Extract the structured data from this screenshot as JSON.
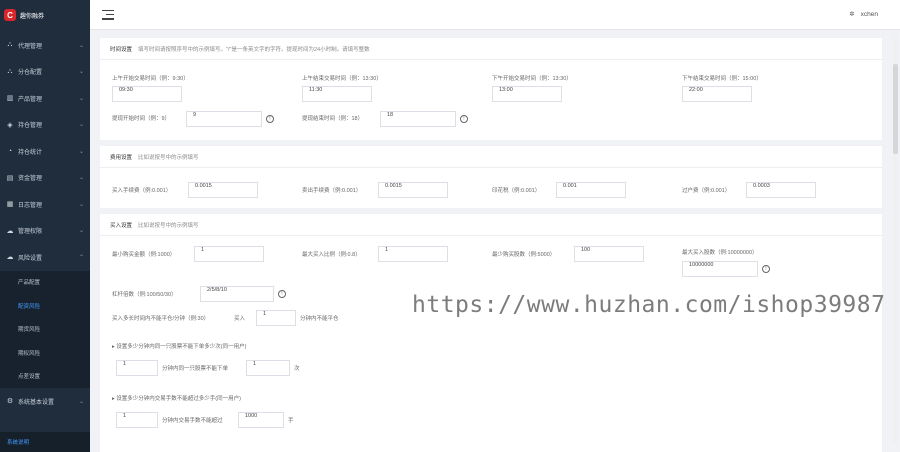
{
  "app": {
    "logo_text": "趣你融券",
    "logo_badge": "C"
  },
  "sidebar": {
    "items": [
      {
        "label": "代理管理",
        "icon": "sitemap-icon"
      },
      {
        "label": "分仓配置",
        "icon": "sitemap-icon"
      },
      {
        "label": "产品管理",
        "icon": "chart-icon"
      },
      {
        "label": "持仓管理",
        "icon": "stack-icon"
      },
      {
        "label": "持仓统计",
        "icon": "pie-icon"
      },
      {
        "label": "资金管理",
        "icon": "wallet-icon"
      },
      {
        "label": "日志管理",
        "icon": "doc-icon"
      },
      {
        "label": "管理权限",
        "icon": "cloud-icon"
      },
      {
        "label": "风险设置",
        "icon": "cloud-icon"
      }
    ],
    "subitems": [
      {
        "label": "产品配置",
        "active": false
      },
      {
        "label": "配资风险",
        "active": true
      },
      {
        "label": "期货风险",
        "active": false
      },
      {
        "label": "期权风险",
        "active": false
      },
      {
        "label": "点差设置",
        "active": false
      }
    ],
    "system_item": {
      "label": "系统基本设置",
      "icon": "gear-icon"
    },
    "footer": "系统说明"
  },
  "topbar": {
    "username": "xchen",
    "user_icon": "gear-icon"
  },
  "time_settings": {
    "title": "时间设置",
    "hint": "填写时间请按照序号中的示例填写。\"/\"是一条英文字的字符。提现时间为24小时制。请填写整数",
    "am_open_label": "上午开始交易时间（例：9:30）",
    "am_open_value": "09:30",
    "am_close_label": "上午结束交易时间（例：13:30）",
    "am_close_value": "11:30",
    "pm_open_label": "下午开始交易时间（例：13:30）",
    "pm_open_value": "13:00",
    "pm_close_label": "下午结束交易时间（例：15:00）",
    "pm_close_value": "22:00",
    "withdraw_start_label": "提现开始时间（例：9）",
    "withdraw_start_value": "9",
    "withdraw_end_label": "提现结束时间（例：18）",
    "withdraw_end_value": "18"
  },
  "fee_settings": {
    "title": "费用设置",
    "hint": "比如说按号中的示例填写",
    "buy_fee_label": "买入手续费（例:0.001）",
    "buy_fee_value": "0.0015",
    "sell_fee_label": "卖出手续费（例:0.001）",
    "sell_fee_value": "0.0015",
    "deferred_label": "印花税（例:0.001）",
    "deferred_value": "0.001",
    "transfer_label": "过户费（例:0.001）",
    "transfer_value": "0.0003"
  },
  "buy_settings": {
    "title": "买入设置",
    "hint": "比如说按号中的示例填写",
    "min_amount_label": "最小购买金额（例:1000）",
    "min_amount_value": "1",
    "max_ratio_label": "最大买入比例（例:0.8）",
    "max_ratio_value": "1",
    "min_lots_label": "最少购买股数（例:5000）",
    "min_lots_value": "100",
    "max_amount_label": "最大买入股数（例:10000000）",
    "max_amount_value": "10000000",
    "leverage_label": "杠杆倍数（例:100/50/30）",
    "leverage_value": "2/5/8/10",
    "buy_limit_label": "买入多长时间内不能平仓/分钟（例:30）",
    "buy_limit_prefix": "买入",
    "buy_limit_value": "1",
    "buy_limit_suffix": "分钟内不能平仓",
    "rule1_header": "设置多少分钟内同一只股票不能下单多少次(同一用户)",
    "rule1_value": "1",
    "rule1_mid": "分钟内同一只股票不能下单",
    "rule1_count": "1",
    "rule1_suffix": "次",
    "rule2_header": "设置多少分钟内交易手数不能超过多少手(同一用户)",
    "rule2_value": "1",
    "rule2_mid": "分钟内交易手数不能超过",
    "rule2_count": "1000",
    "rule2_suffix": "手"
  },
  "watermark": "https://www.huzhan.com/ishop39987"
}
